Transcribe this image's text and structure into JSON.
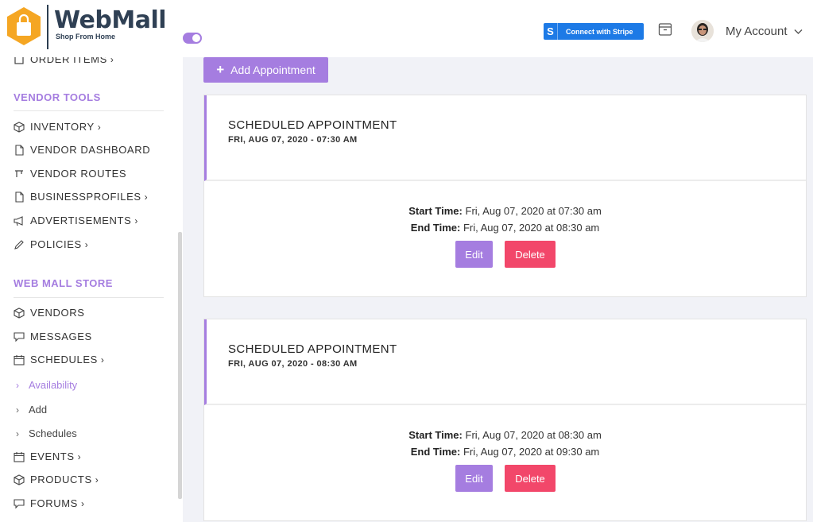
{
  "header": {
    "brand": "WebMall",
    "tagline": "Shop From Home",
    "stripe_label": "Connect with Stripe",
    "stripe_s": "S",
    "account_label": "My Account"
  },
  "sidebar": {
    "partial_item": "ORDER ITEMS",
    "sections": [
      {
        "heading": "VENDOR TOOLS",
        "items": [
          "INVENTORY",
          "VENDOR DASHBOARD",
          "VENDOR ROUTES",
          "BUSINESSPROFILES",
          "ADVERTISEMENTS",
          "POLICIES"
        ]
      },
      {
        "heading": "WEB MALL STORE",
        "items": [
          "VENDORS",
          "MESSAGES",
          "SCHEDULES",
          "EVENTS",
          "PRODUCTS",
          "FORUMS"
        ]
      }
    ],
    "sub_items": [
      "Availability",
      "Add",
      "Schedules"
    ]
  },
  "main": {
    "add_button": "Add Appointment",
    "appointments": [
      {
        "title": "SCHEDULED APPOINTMENT",
        "date": "FRI, AUG 07, 2020 - 07:30 AM",
        "start_label": "Start Time:",
        "start_value": "Fri, Aug 07, 2020 at 07:30 am",
        "end_label": "End Time:",
        "end_value": "Fri, Aug 07, 2020 at 08:30 am",
        "edit": "Edit",
        "delete": "Delete"
      },
      {
        "title": "SCHEDULED APPOINTMENT",
        "date": "FRI, AUG 07, 2020 - 08:30 AM",
        "start_label": "Start Time:",
        "start_value": "Fri, Aug 07, 2020 at 08:30 am",
        "end_label": "End Time:",
        "end_value": "Fri, Aug 07, 2020 at 09:30 am",
        "edit": "Edit",
        "delete": "Delete"
      }
    ]
  },
  "colors": {
    "accent": "#a57de0",
    "danger": "#f2476a",
    "stripe": "#1d7ae6",
    "logo_orange": "#f5a623"
  }
}
